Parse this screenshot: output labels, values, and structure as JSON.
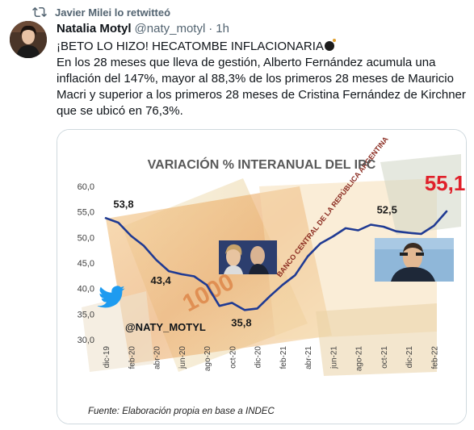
{
  "retweet": {
    "text": "Javier Milei lo retwitteó",
    "icon": "retweet-icon"
  },
  "author": {
    "name": "Natalia Motyl",
    "handle": "@naty_motyl",
    "separator": "·",
    "time": "1h"
  },
  "tweet": {
    "line1": "¡BETO LO HIZO! HECATOMBE INFLACIONARIA",
    "emoji": "bomb-emoji",
    "body": "En los 28 meses que lleva de gestión, Alberto Fernández acumula una inflación del 147%, mayor al 88,3% de los primeros 28 meses de Mauricio Macri y superior a los primeros 28 meses de Cristina Fernández de Kirchner que se ubicó en 76,3%."
  },
  "image": {
    "watermark": "@NATY_MOTYL",
    "watermark_icon": "twitter-bird-icon",
    "banknote_text": "BANCO CENTRAL DE LA REPÚBLICA ARGENTINA",
    "banknote_value": "1000",
    "source": "Fuente: Elaboración propia en base a INDEC"
  },
  "chart_data": {
    "type": "line",
    "title": "VARIACIÓN % INTERANUAL DEL IPC",
    "ylim": [
      30,
      60
    ],
    "yticks": [
      "60,0",
      "55,0",
      "50,0",
      "45,0",
      "40,0",
      "35,0",
      "30,0"
    ],
    "ytick_values": [
      60,
      55,
      50,
      45,
      40,
      35,
      30
    ],
    "xticks": [
      "dic-19",
      "feb-20",
      "abr-20",
      "jun-20",
      "ago-20",
      "oct-20",
      "dic-20",
      "feb-21",
      "abr-21",
      "jun-21",
      "ago-21",
      "oct-21",
      "dic-21",
      "feb-22"
    ],
    "grid": false,
    "line_color": "#1f3a93",
    "series": [
      {
        "x": [
          "dic-19",
          "ene-20",
          "feb-20",
          "mar-20",
          "abr-20",
          "may-20",
          "jun-20",
          "jul-20",
          "ago-20",
          "sep-20",
          "oct-20",
          "nov-20",
          "dic-20",
          "ene-21",
          "feb-21",
          "mar-21",
          "abr-21",
          "may-21",
          "jun-21",
          "jul-21",
          "ago-21",
          "sep-21",
          "oct-21",
          "nov-21",
          "dic-21",
          "ene-22",
          "feb-22",
          "mar-22"
        ],
        "values": [
          53.8,
          52.9,
          50.3,
          48.4,
          45.6,
          43.4,
          42.8,
          42.4,
          40.7,
          36.6,
          37.2,
          35.8,
          36.1,
          38.5,
          40.7,
          42.6,
          46.3,
          48.8,
          50.2,
          51.8,
          51.4,
          52.5,
          52.1,
          51.2,
          50.9,
          50.7,
          52.3,
          55.1
        ]
      }
    ],
    "annotations": [
      {
        "label": "53,8",
        "x": "dic-19",
        "highlight": false
      },
      {
        "label": "43,4",
        "x": "may-20",
        "highlight": false
      },
      {
        "label": "35,8",
        "x": "nov-20",
        "highlight": false
      },
      {
        "label": "52,5",
        "x": "sep-21",
        "highlight": false
      },
      {
        "label": "55,1",
        "x": "mar-22",
        "highlight": true
      }
    ],
    "highlight_color": "#e0202a"
  }
}
